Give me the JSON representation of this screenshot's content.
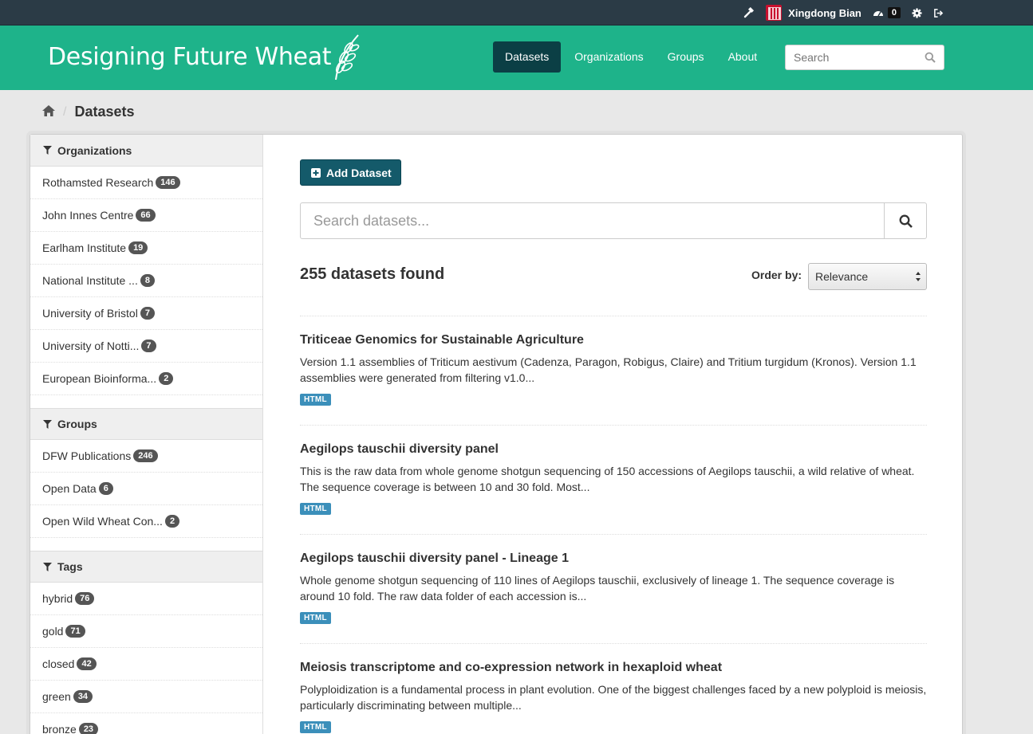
{
  "account": {
    "user_name": "Xingdong Bian",
    "activity_count": "0"
  },
  "site": {
    "title": "Designing Future Wheat",
    "nav": [
      "Datasets",
      "Organizations",
      "Groups",
      "About"
    ],
    "search_placeholder": "Search"
  },
  "breadcrumb": {
    "current": "Datasets"
  },
  "facets": {
    "organizations": {
      "heading": "Organizations",
      "items": [
        {
          "label": "Rothamsted Research",
          "count": "146"
        },
        {
          "label": "John Innes Centre",
          "count": "66"
        },
        {
          "label": "Earlham Institute",
          "count": "19"
        },
        {
          "label": "National Institute ...",
          "count": "8"
        },
        {
          "label": "University of Bristol",
          "count": "7"
        },
        {
          "label": "University of Notti...",
          "count": "7"
        },
        {
          "label": "European Bioinforma...",
          "count": "2"
        }
      ]
    },
    "groups": {
      "heading": "Groups",
      "items": [
        {
          "label": "DFW Publications",
          "count": "246"
        },
        {
          "label": "Open Data",
          "count": "6"
        },
        {
          "label": "Open Wild Wheat Con...",
          "count": "2"
        }
      ]
    },
    "tags": {
      "heading": "Tags",
      "items": [
        {
          "label": "hybrid",
          "count": "76"
        },
        {
          "label": "gold",
          "count": "71"
        },
        {
          "label": "closed",
          "count": "42"
        },
        {
          "label": "green",
          "count": "34"
        },
        {
          "label": "bronze",
          "count": "23"
        }
      ]
    }
  },
  "main": {
    "add_button": "Add Dataset",
    "search_placeholder": "Search datasets...",
    "results_count": "255 datasets found",
    "order_label": "Order by:",
    "order_value": "Relevance",
    "datasets": [
      {
        "title": "Triticeae Genomics for Sustainable Agriculture",
        "notes": "Version 1.1 assemblies of Triticum aestivum (Cadenza, Paragon, Robigus, Claire) and Tritium turgidum (Kronos). Version 1.1 assemblies were generated from filtering v1.0...",
        "format": "HTML"
      },
      {
        "title": "Aegilops tauschii diversity panel",
        "notes": "This is the raw data from whole genome shotgun sequencing of 150 accessions of Aegilops tauschii, a wild relative of wheat. The sequence coverage is between 10 and 30 fold. Most...",
        "format": "HTML"
      },
      {
        "title": "Aegilops tauschii diversity panel - Lineage 1",
        "notes": "Whole genome shotgun sequencing of 110 lines of Aegilops tauschii, exclusively of lineage 1. The sequence coverage is around 10 fold. The raw data folder of each accession is...",
        "format": "HTML"
      },
      {
        "title": "Meiosis transcriptome and co-expression network in hexaploid wheat",
        "notes": "Polyploidization is a fundamental process in plant evolution. One of the biggest challenges faced by a new polyploid is meiosis, particularly discriminating between multiple...",
        "format": "HTML"
      }
    ]
  },
  "colors": {
    "masthead": "#1eb38a",
    "account_bar": "#2b3b46",
    "nav_active": "#0b3f45",
    "primary_button": "#145a6a",
    "format_label": "#3b8fba"
  }
}
